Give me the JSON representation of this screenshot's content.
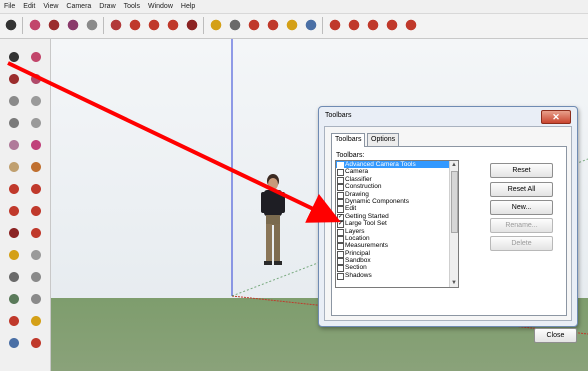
{
  "menu": [
    "File",
    "Edit",
    "View",
    "Camera",
    "Draw",
    "Tools",
    "Window",
    "Help"
  ],
  "top_toolbar_icons": [
    {
      "name": "select-icon",
      "color": "#333333"
    },
    {
      "name": "eraser-icon",
      "color": "#c2466b"
    },
    {
      "name": "line-icon",
      "color": "#9b2c2c"
    },
    {
      "name": "arc-icon",
      "color": "#8a3a6b"
    },
    {
      "name": "rectangle-icon",
      "color": "#8a8a8a"
    },
    {
      "name": "push-pull-icon",
      "color": "#b23a3a"
    },
    {
      "name": "offset-icon",
      "color": "#c0392b"
    },
    {
      "name": "move-icon",
      "color": "#c0392b"
    },
    {
      "name": "rotate-icon",
      "color": "#c0392b"
    },
    {
      "name": "scale-icon",
      "color": "#8b2323"
    },
    {
      "name": "tape-measure-icon",
      "color": "#d4a017"
    },
    {
      "name": "text-icon",
      "color": "#6a6a6a"
    },
    {
      "name": "paint-bucket-icon",
      "color": "#c0392b"
    },
    {
      "name": "orbit-icon",
      "color": "#c0392b"
    },
    {
      "name": "pan-icon",
      "color": "#d4a017"
    },
    {
      "name": "zoom-icon",
      "color": "#4a6fa5"
    },
    {
      "name": "zoom-extents-icon",
      "color": "#c0392b"
    },
    {
      "name": "3d-warehouse-icon",
      "color": "#c0392b"
    },
    {
      "name": "components-icon",
      "color": "#c0392b"
    },
    {
      "name": "share-model-icon",
      "color": "#c0392b"
    },
    {
      "name": "extension-warehouse-icon",
      "color": "#c0392b"
    }
  ],
  "dialog": {
    "title": "Toolbars",
    "close_glyph": "✕",
    "tabs": [
      "Toolbars",
      "Options"
    ],
    "list_label": "Toolbars:",
    "items": [
      {
        "label": "Advanced Camera Tools",
        "checked": false,
        "selected": true
      },
      {
        "label": "Camera",
        "checked": false,
        "selected": false
      },
      {
        "label": "Classifier",
        "checked": false,
        "selected": false
      },
      {
        "label": "Construction",
        "checked": false,
        "selected": false
      },
      {
        "label": "Drawing",
        "checked": false,
        "selected": false
      },
      {
        "label": "Dynamic Components",
        "checked": false,
        "selected": false
      },
      {
        "label": "Edit",
        "checked": false,
        "selected": false
      },
      {
        "label": "Getting Started",
        "checked": true,
        "selected": false
      },
      {
        "label": "Large Tool Set",
        "checked": true,
        "selected": false
      },
      {
        "label": "Layers",
        "checked": false,
        "selected": false
      },
      {
        "label": "Location",
        "checked": false,
        "selected": false
      },
      {
        "label": "Measurements",
        "checked": false,
        "selected": false
      },
      {
        "label": "Principal",
        "checked": false,
        "selected": false
      },
      {
        "label": "Sandbox",
        "checked": false,
        "selected": false
      },
      {
        "label": "Section",
        "checked": false,
        "selected": false
      },
      {
        "label": "Shadows",
        "checked": false,
        "selected": false
      }
    ],
    "buttons": [
      {
        "label": "Reset",
        "enabled": true
      },
      {
        "label": "Reset All",
        "enabled": true
      },
      {
        "label": "New...",
        "enabled": true
      },
      {
        "label": "Rename...",
        "enabled": false
      },
      {
        "label": "Delete",
        "enabled": false
      }
    ],
    "close_label": "Close"
  },
  "colors": {
    "annotation_arrow": "#ff0000",
    "blue_axis": "#2b3fd6",
    "red_axis": "#c0392b",
    "green_axis": "#2e7d32",
    "ground": "#849f73",
    "sky": "#eef1f4",
    "list_selection": "#3399ff"
  }
}
